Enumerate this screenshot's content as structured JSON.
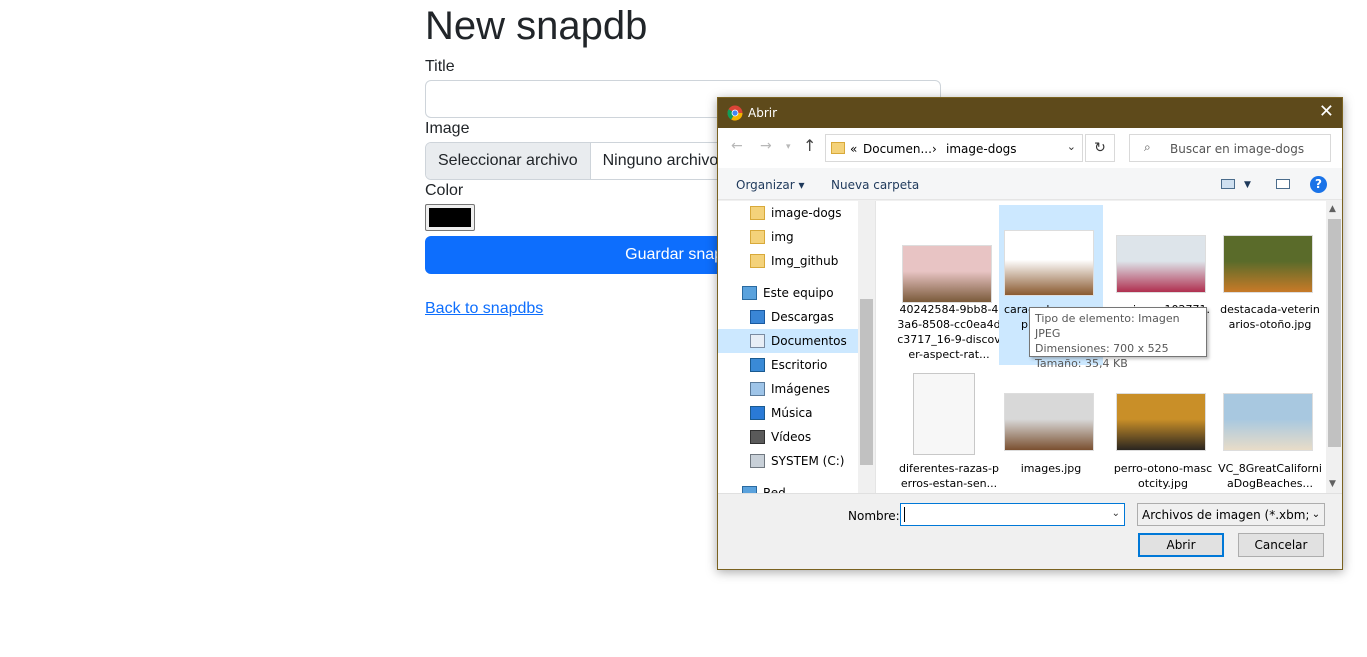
{
  "form": {
    "heading": "New snapdb",
    "title_label": "Title",
    "title_value": "",
    "image_label": "Image",
    "file_button": "Seleccionar archivo",
    "file_status": "Ninguno archivo",
    "color_label": "Color",
    "color_value": "#000000",
    "submit_label": "Guardar snapdb",
    "back_link": "Back to snapdbs"
  },
  "dialog": {
    "title": "Abrir",
    "close_glyph": "✕",
    "address": {
      "overflow": "«",
      "crumb1": "Documen...",
      "sep": "›",
      "crumb2": "image-dogs"
    },
    "search_placeholder": "Buscar en image-dogs",
    "toolbar": {
      "organize": "Organizar",
      "new_folder": "Nueva carpeta",
      "help": "?"
    },
    "nav_items": [
      {
        "label": "image-dogs",
        "icon": "folder-icon"
      },
      {
        "label": "img",
        "icon": "folder-icon"
      },
      {
        "label": "Img_github",
        "icon": "folder-icon"
      },
      {
        "label": "Este equipo",
        "icon": "computer-icon"
      },
      {
        "label": "Descargas",
        "icon": "download-icon"
      },
      {
        "label": "Documentos",
        "icon": "documents-icon",
        "selected": true
      },
      {
        "label": "Escritorio",
        "icon": "desktop-icon"
      },
      {
        "label": "Imágenes",
        "icon": "pictures-icon"
      },
      {
        "label": "Música",
        "icon": "music-icon"
      },
      {
        "label": "Vídeos",
        "icon": "videos-icon"
      },
      {
        "label": "SYSTEM (C:)",
        "icon": "drive-icon"
      },
      {
        "label": "Red",
        "icon": "network-icon"
      }
    ],
    "files": [
      {
        "name": "40242584-9bb8-43a6-8508-cc0ea4dc3717_16-9-discover-aspect-rat...",
        "type": "image",
        "colors": [
          "#e8c4c4",
          "#7a5a3a"
        ]
      },
      {
        "name": "cara-...-los-...-omp...-1-1.jpg",
        "type": "image",
        "selected": true,
        "colors": [
          "#ffffff",
          "#8a5a30"
        ]
      },
      {
        "name": "...viemo-102771.j...",
        "type": "image",
        "colors": [
          "#dde4ea",
          "#b03050"
        ]
      },
      {
        "name": "destacada-veterinarios-otoño.jpg",
        "type": "image",
        "colors": [
          "#5a6b2a",
          "#c87a28"
        ]
      },
      {
        "name": "diferentes-razas-perros-estan-sen...",
        "type": "document",
        "colors": [
          "#f7f7f7",
          "#c8c8c8"
        ]
      },
      {
        "name": "images.jpg",
        "type": "image",
        "colors": [
          "#d8d8d8",
          "#7a5030"
        ]
      },
      {
        "name": "perro-otono-mascotcity.jpg",
        "type": "image",
        "colors": [
          "#c98f28",
          "#2a2520"
        ]
      },
      {
        "name": "VC_8GreatCaliforniaDogBeaches...",
        "type": "image",
        "colors": [
          "#a8c8e0",
          "#e8dcc8"
        ]
      }
    ],
    "tooltip": [
      "Tipo de elemento: Imagen JPEG",
      "Dimensiones: 700 x 525",
      "Tamaño: 35,4 KB"
    ],
    "filename_label": "Nombre:",
    "filename_value": "",
    "filter": "Archivos de imagen (*.xbm;*.tiff",
    "open_button": "Abrir",
    "cancel_button": "Cancelar"
  }
}
